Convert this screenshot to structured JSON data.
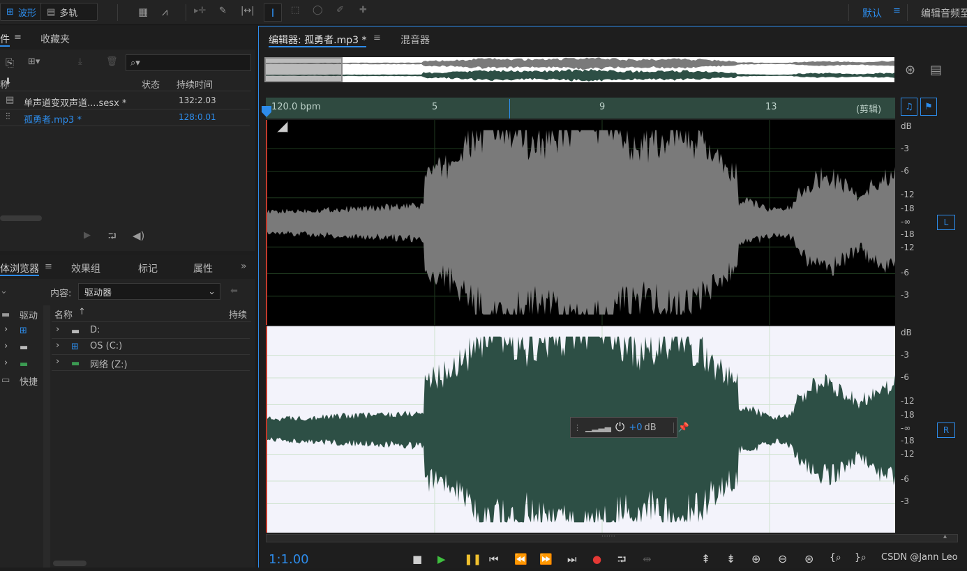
{
  "toolbar": {
    "waveform_tab": "波形",
    "multitrack_tab": "多轨",
    "workspace_label": "默认",
    "edit_audio_label": "编辑音频至"
  },
  "files_panel": {
    "tab_files": "件",
    "tab_favorites": "收藏夹",
    "col_name": "称",
    "col_status": "状态",
    "col_duration": "持续时间",
    "search_placeholder": "",
    "items": [
      {
        "name": "单声道变双声道....sesx *",
        "duration": "132:2.03",
        "active": false
      },
      {
        "name": "孤勇者.mp3 *",
        "duration": "128:0.01",
        "active": true
      }
    ]
  },
  "browser_panel": {
    "tab_media": "体浏览器",
    "tab_effects": "效果组",
    "tab_markers": "标记",
    "tab_properties": "属性",
    "content_label": "内容:",
    "content_value": "驱动器",
    "tree": {
      "drives_label": "驱动",
      "shortcuts_label": "快捷"
    },
    "col_name": "名称",
    "col_duration": "持续",
    "drives": [
      {
        "label": "D:"
      },
      {
        "label": "OS (C:)"
      },
      {
        "label": "网络 (Z:)"
      }
    ]
  },
  "editor": {
    "tab_editor": "编辑器: 孤勇者.mp3 *",
    "tab_mixer": "混音器",
    "ruler": {
      "tempo": "120.0 bpm",
      "marks": [
        "5",
        "9",
        "13"
      ],
      "clip_label": "(剪辑)"
    },
    "channel_left": "L",
    "channel_right": "R",
    "db_unit": "dB",
    "db_labels": [
      "-3",
      "-6",
      "-12",
      "-18",
      "-∞",
      "-18",
      "-12",
      "-6",
      "-3"
    ],
    "hud_value": "+0",
    "hud_unit": "dB",
    "time_display": "1:1.00",
    "watermark": "CSDN @Jann Leo"
  },
  "colors": {
    "accent": "#2d8ceb",
    "left_wave": "#7a7a7a",
    "right_wave": "#2d4f45",
    "ruler_bg": "#2f4a40",
    "record": "#e53935",
    "play": "#3fbf3f",
    "pause": "#f2c12e"
  }
}
